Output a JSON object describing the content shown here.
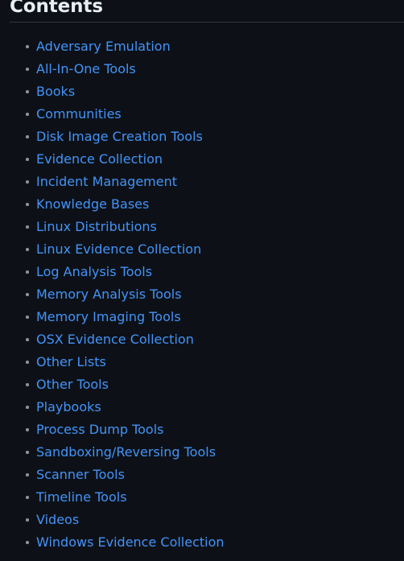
{
  "heading": {
    "title": "Contents"
  },
  "icons": {
    "bullet": "bullet-point-icon"
  },
  "colors": {
    "background": "#0d1117",
    "heading_text": "#e6edf3",
    "link": "#4493f8",
    "bullet": "#8b949e",
    "rule": "#30363d"
  },
  "toc": {
    "items": [
      {
        "label": "Adversary Emulation"
      },
      {
        "label": "All-In-One Tools"
      },
      {
        "label": "Books"
      },
      {
        "label": "Communities"
      },
      {
        "label": "Disk Image Creation Tools"
      },
      {
        "label": "Evidence Collection"
      },
      {
        "label": "Incident Management"
      },
      {
        "label": "Knowledge Bases"
      },
      {
        "label": "Linux Distributions"
      },
      {
        "label": "Linux Evidence Collection"
      },
      {
        "label": "Log Analysis Tools"
      },
      {
        "label": "Memory Analysis Tools"
      },
      {
        "label": "Memory Imaging Tools"
      },
      {
        "label": "OSX Evidence Collection"
      },
      {
        "label": "Other Lists"
      },
      {
        "label": "Other Tools"
      },
      {
        "label": "Playbooks"
      },
      {
        "label": "Process Dump Tools"
      },
      {
        "label": "Sandboxing/Reversing Tools"
      },
      {
        "label": "Scanner Tools"
      },
      {
        "label": "Timeline Tools"
      },
      {
        "label": "Videos"
      },
      {
        "label": "Windows Evidence Collection"
      }
    ]
  }
}
